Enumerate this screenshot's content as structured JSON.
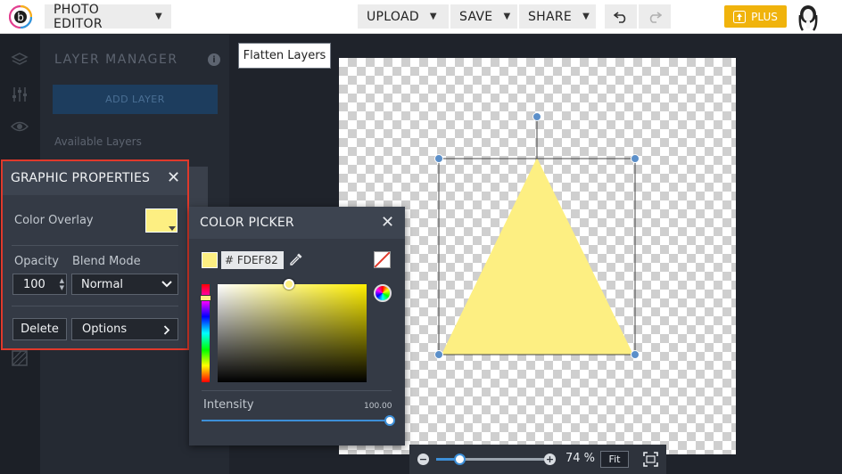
{
  "topbar": {
    "app_menu": "PHOTO EDITOR",
    "upload": "UPLOAD",
    "save": "SAVE",
    "share": "SHARE",
    "plus": "PLUS"
  },
  "layer_manager": {
    "title": "LAYER MANAGER",
    "add_layer": "ADD LAYER",
    "available_layers": "Available Layers"
  },
  "canvas": {
    "flatten_label": "Flatten Layers",
    "shape_fill": "#FDEF82"
  },
  "zoom": {
    "percent": "74 %",
    "fit": "Fit"
  },
  "graphic_properties": {
    "title": "GRAPHIC PROPERTIES",
    "color_overlay_label": "Color Overlay",
    "opacity_label": "Opacity",
    "opacity_value": "100",
    "blend_mode_label": "Blend Mode",
    "blend_mode_value": "Normal",
    "delete": "Delete",
    "options": "Options"
  },
  "color_picker": {
    "title": "COLOR PICKER",
    "hex": "# FDEF82",
    "intensity_label": "Intensity",
    "intensity_value": "100.00"
  },
  "colors": {
    "accent": "#3d8fd8",
    "plus": "#f0b30c",
    "highlight": "#e0392b",
    "selected": "#FDEF82"
  }
}
